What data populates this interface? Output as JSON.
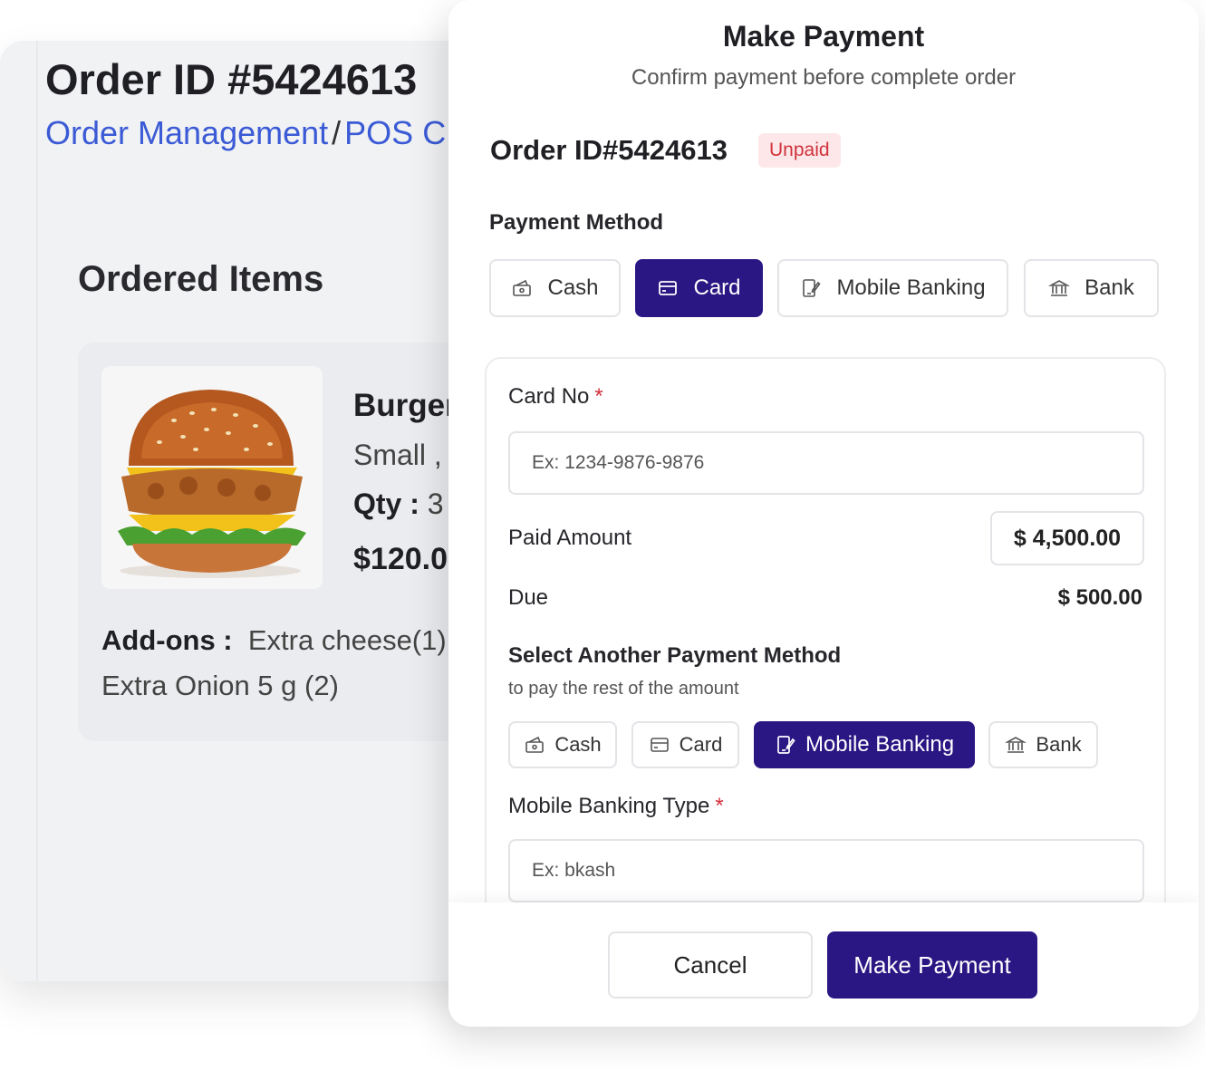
{
  "background": {
    "order_title": "Order ID #5424613",
    "breadcrumb": {
      "parent": "Order Management",
      "separator": "/",
      "current": "POS C"
    },
    "ordered_items_title": "Ordered Items",
    "item": {
      "name": "Burger",
      "variant": "Small ,",
      "qty_label": "Qty :",
      "qty_value": "3",
      "price": "$120.0",
      "addons_label": "Add-ons :",
      "addons_line1": "Extra cheese(1),",
      "addons_line2": "Extra Onion 5 g (2)"
    }
  },
  "modal": {
    "title": "Make Payment",
    "subtitle": "Confirm payment before complete order",
    "order_id": "Order ID#5424613",
    "status_badge": "Unpaid",
    "payment_method_label": "Payment Method",
    "payment_methods": [
      {
        "label": "Cash",
        "icon": "cash-icon",
        "active": false
      },
      {
        "label": "Card",
        "icon": "card-icon",
        "active": true
      },
      {
        "label": "Mobile Banking",
        "icon": "mobile-banking-icon",
        "active": false
      },
      {
        "label": "Bank",
        "icon": "bank-icon",
        "active": false
      }
    ],
    "card_no_label": "Card No",
    "required_mark": "*",
    "card_no_placeholder": "Ex: 1234-9876-9876",
    "paid_amount_label": "Paid Amount",
    "paid_amount_value": "$ 4,500.00",
    "due_label": "Due",
    "due_value": "$ 500.00",
    "another_method_title": "Select Another Payment Method",
    "another_method_sub": "to pay the rest of the amount",
    "secondary_methods": [
      {
        "label": "Cash",
        "icon": "cash-icon",
        "active": false
      },
      {
        "label": "Card",
        "icon": "card-icon",
        "active": false
      },
      {
        "label": "Mobile Banking",
        "icon": "mobile-banking-icon",
        "active": true
      },
      {
        "label": "Bank",
        "icon": "bank-icon",
        "active": false
      }
    ],
    "mobile_banking_type_label": "Mobile Banking Type",
    "mobile_banking_type_placeholder": "Ex: bkash",
    "cancel_label": "Cancel",
    "submit_label": "Make Payment"
  },
  "colors": {
    "primary": "#2b1783",
    "link": "#3b5bd6",
    "danger": "#d0323c",
    "badge_bg": "#fde7e9"
  }
}
